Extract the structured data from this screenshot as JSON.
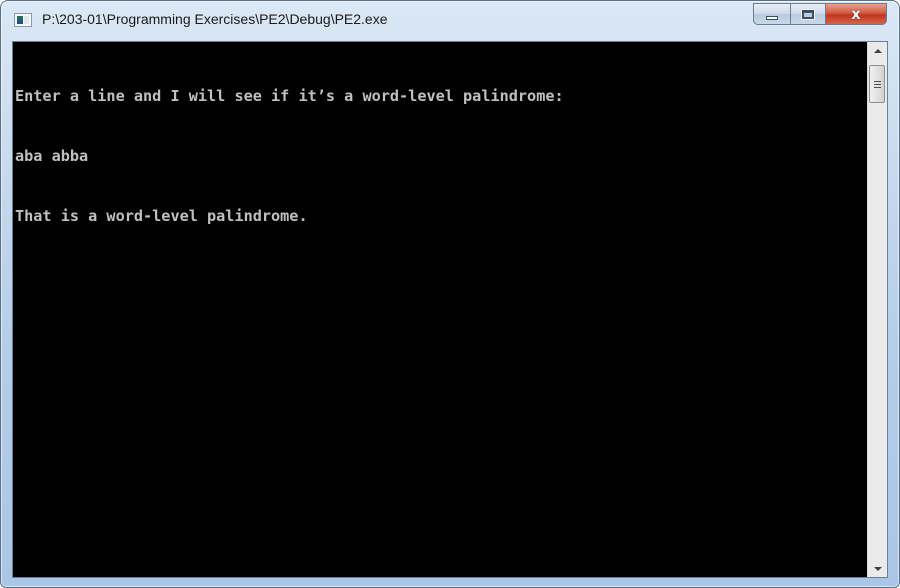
{
  "window": {
    "title": "P:\\203-01\\Programming Exercises\\PE2\\Debug\\PE2.exe",
    "icon": "console-app-icon",
    "caption_buttons": {
      "minimize": "minimize-icon",
      "maximize": "maximize-icon",
      "close_glyph": "x"
    }
  },
  "console": {
    "background": "#000000",
    "foreground": "#c0c0c0",
    "lines": [
      "Enter a line and I will see if it’s a word-level palindrome:",
      "aba abba",
      "That is a word-level palindrome."
    ]
  },
  "scrollbar": {
    "orientation": "vertical",
    "position": 0
  }
}
